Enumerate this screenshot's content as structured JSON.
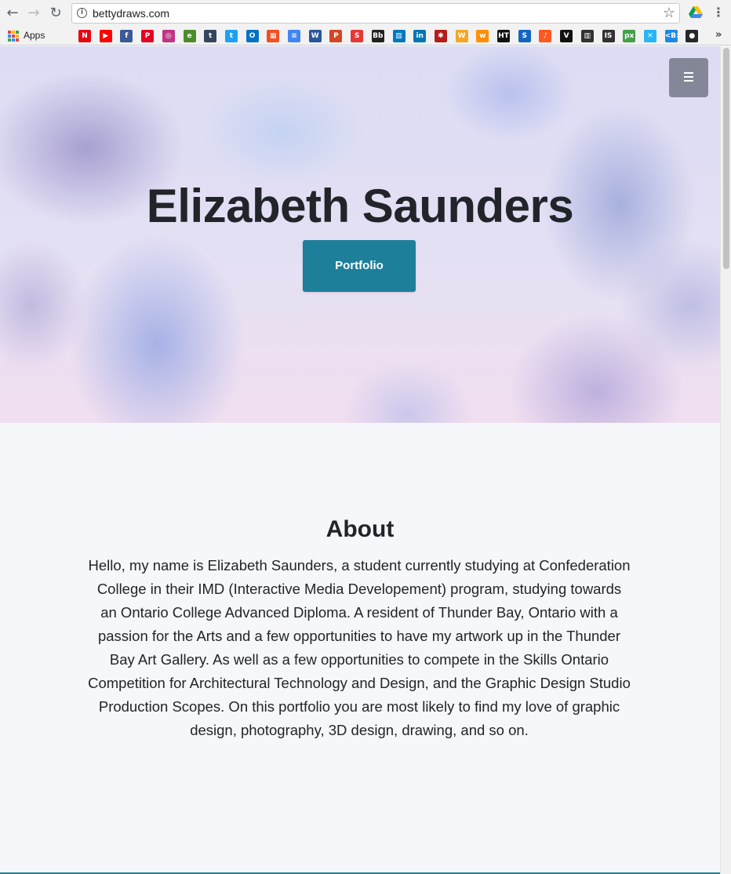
{
  "browser": {
    "url": "bettydraws.com",
    "bookmarks_bar": {
      "apps_label": "Apps",
      "items": [
        {
          "name": "netflix",
          "glyph": "N",
          "color": "#e50914"
        },
        {
          "name": "youtube",
          "glyph": "▶",
          "color": "#ff0000"
        },
        {
          "name": "facebook",
          "glyph": "f",
          "color": "#3b5998"
        },
        {
          "name": "pinterest",
          "glyph": "P",
          "color": "#e60023"
        },
        {
          "name": "instagram",
          "glyph": "◎",
          "color": "#c13584"
        },
        {
          "name": "evernote-like",
          "glyph": "e",
          "color": "#4c8c2b"
        },
        {
          "name": "tumblr",
          "glyph": "t",
          "color": "#35465c"
        },
        {
          "name": "twitter",
          "glyph": "t",
          "color": "#1da1f2"
        },
        {
          "name": "outlook",
          "glyph": "O",
          "color": "#0072c6"
        },
        {
          "name": "microsoft",
          "glyph": "▦",
          "color": "#f25022"
        },
        {
          "name": "google-docs",
          "glyph": "≡",
          "color": "#4285f4"
        },
        {
          "name": "word",
          "glyph": "W",
          "color": "#2b579a"
        },
        {
          "name": "powerpoint",
          "glyph": "P",
          "color": "#d24726"
        },
        {
          "name": "s-app",
          "glyph": "S",
          "color": "#e53935"
        },
        {
          "name": "blackboard",
          "glyph": "Bb",
          "color": "#222222"
        },
        {
          "name": "trello",
          "glyph": "▥",
          "color": "#0079bf"
        },
        {
          "name": "linkedin",
          "glyph": "in",
          "color": "#0077b5"
        },
        {
          "name": "ant-app",
          "glyph": "✱",
          "color": "#b71c1c"
        },
        {
          "name": "w-app",
          "glyph": "W",
          "color": "#f5a623"
        },
        {
          "name": "wattpad-like",
          "glyph": "w",
          "color": "#ff8f00"
        },
        {
          "name": "ht-app",
          "glyph": "HT",
          "color": "#111111"
        },
        {
          "name": "shazam-like",
          "glyph": "S",
          "color": "#1565c0"
        },
        {
          "name": "music-app",
          "glyph": "♪",
          "color": "#ff5722"
        },
        {
          "name": "v-app",
          "glyph": "V",
          "color": "#111111"
        },
        {
          "name": "library-app",
          "glyph": "▥",
          "color": "#333333"
        },
        {
          "name": "is-app",
          "glyph": "IS",
          "color": "#333333"
        },
        {
          "name": "px-app",
          "glyph": "px",
          "color": "#43a047"
        },
        {
          "name": "x-app",
          "glyph": "✕",
          "color": "#29b6f6"
        },
        {
          "name": "b-app",
          "glyph": "<B>",
          "color": "#1e88e5"
        },
        {
          "name": "github",
          "glyph": "●",
          "color": "#24292e"
        }
      ],
      "overflow_glyph": "»"
    }
  },
  "page": {
    "hero": {
      "title": "Elizabeth Saunders",
      "button_label": "Portfolio"
    },
    "about": {
      "heading": "About",
      "body": "Hello, my name is Elizabeth Saunders, a student currently studying at Confederation College in their IMD (Interactive Media Developement) program, studying towards an Ontario College Advanced Diploma. A resident of Thunder Bay, Ontario with a passion for the Arts and a few opportunities to have my artwork up in the Thunder Bay Art Gallery. As well as a few opportunities to compete in the Skills Ontario Competition for Architectural Technology and Design, and the Graphic Design Studio Production Scopes. On this portfolio you are most likely to find my love of graphic design, photography, 3D design, drawing, and so on."
    }
  },
  "colors": {
    "accent": "#1e7f9a",
    "text": "#212529"
  }
}
